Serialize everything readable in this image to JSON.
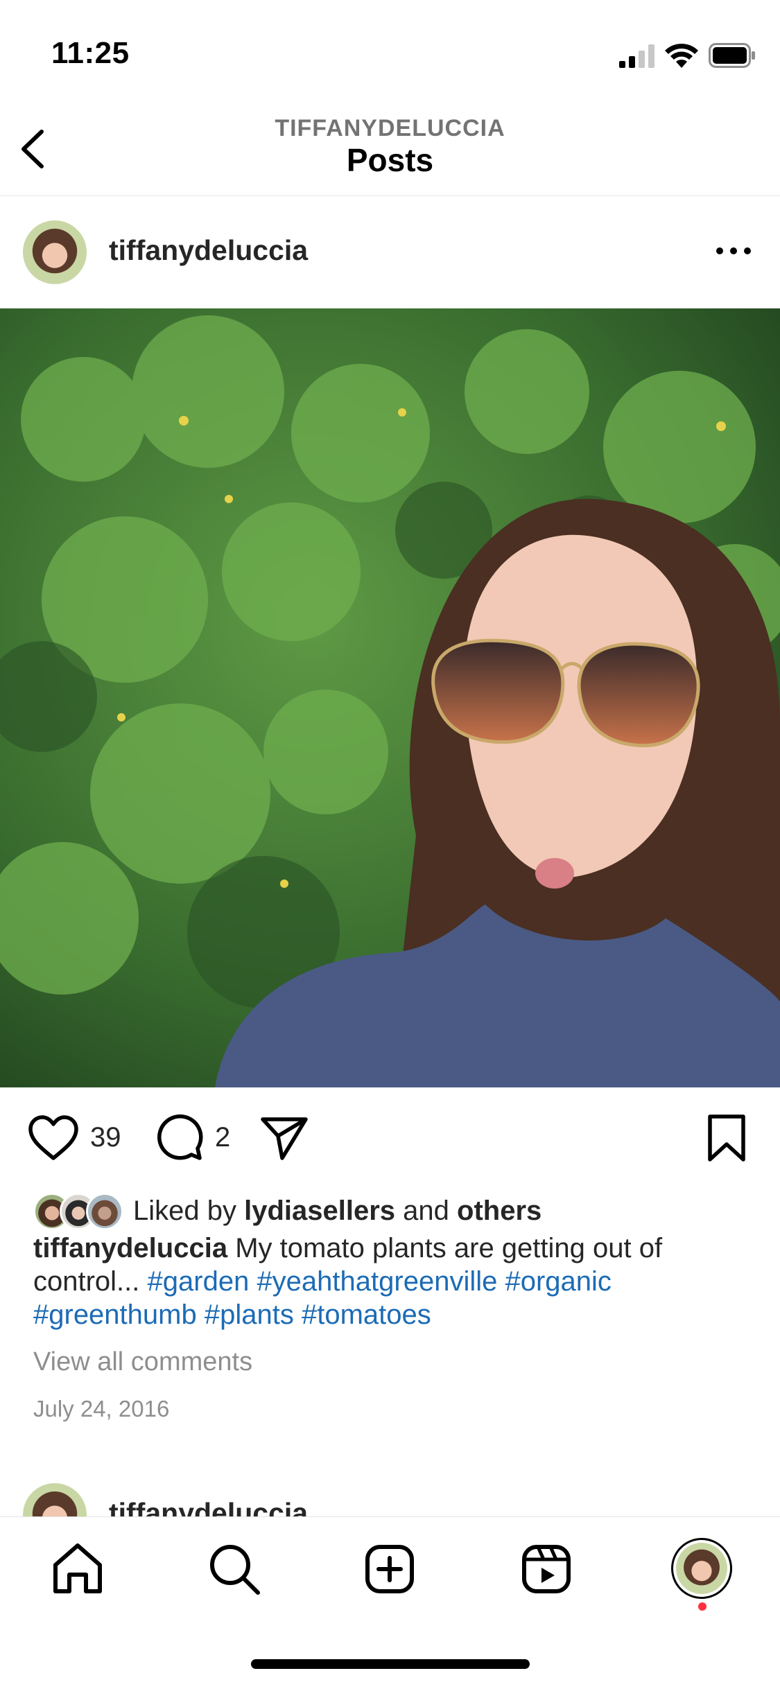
{
  "status_bar": {
    "time": "11:25"
  },
  "nav": {
    "subtitle": "TIFFANYDELUCCIA",
    "title": "Posts"
  },
  "post": {
    "username": "tiffanydeluccia",
    "image_description_icon": "photo",
    "like_count": "39",
    "comment_count": "2",
    "liked_by": {
      "prefix": "Liked by ",
      "user": "lydiasellers",
      "middle": " and ",
      "others": "others"
    },
    "caption": {
      "username": "tiffanydeluccia",
      "text": " My tomato plants are getting out of control... ",
      "hashtags": [
        "#garden",
        "#yeahthatgreenville",
        "#organic",
        "#greenthumb",
        "#plants",
        "#tomatoes"
      ]
    },
    "view_comments": "View all comments",
    "date": "July 24, 2016"
  },
  "next_post": {
    "username": "tiffanydeluccia"
  },
  "icons": {
    "back": "chevron-left-icon",
    "more": "more-horizontal-icon",
    "like": "heart-icon",
    "comment": "comment-icon",
    "share": "paper-plane-icon",
    "save": "bookmark-icon",
    "home": "home-icon",
    "search": "search-icon",
    "create": "plus-square-icon",
    "reels": "reels-icon"
  },
  "colors": {
    "text": "#262626",
    "hashtag": "#1c6bb5",
    "muted": "#8e8e8e",
    "notification_dot": "#ff3040"
  }
}
